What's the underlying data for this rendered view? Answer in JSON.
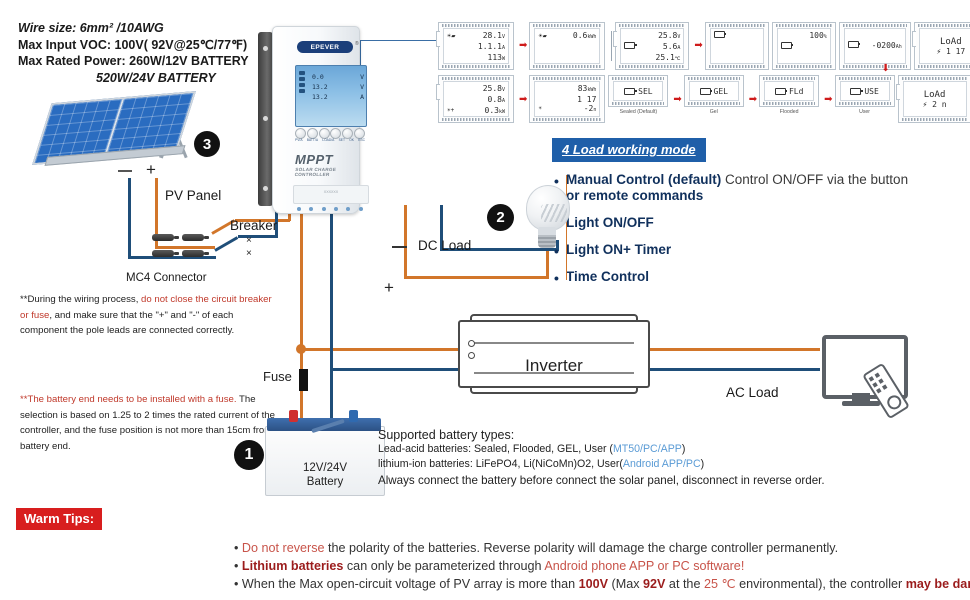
{
  "spec": {
    "line1": "Wire size: 6mm² /10AWG",
    "line2": "Max Input VOC: 100V( 92V@25℃/77℉)",
    "line3": "Max Rated  Power: 260W/12V BATTERY",
    "line4": "520W/24V BATTERY"
  },
  "controller": {
    "brand": "EPEVER",
    "brand_sup": "®",
    "mppt": "MPPT",
    "subtitle": "SOLAR CHARGE CONTROLLER",
    "lcd": [
      {
        "value": "0.0",
        "unit": "V"
      },
      {
        "value": "13.2",
        "unit": "V"
      },
      {
        "value": "13.2",
        "unit": "A"
      }
    ],
    "button_labels": [
      "PV/A",
      "BATT/A",
      "LOAD/A",
      "SET",
      "OK",
      "ESC"
    ],
    "foot_text": "XXXXXX"
  },
  "lcd_screens": {
    "row1": [
      {
        "icons": [
          "pv"
        ],
        "lines": [
          {
            "v": "28.1",
            "u": "V"
          },
          {
            "v": "1.1.1",
            "u": "A"
          },
          {
            "v": "113",
            "u": "W"
          }
        ]
      },
      {
        "icons": [
          "pv"
        ],
        "lines": [
          {
            "v": "0.6",
            "u": "kWh"
          }
        ]
      },
      {
        "icons": [
          "battery"
        ],
        "lines": [
          {
            "v": "25.8",
            "u": "V"
          },
          {
            "v": "5.6",
            "u": "A"
          },
          {
            "v": "25.1",
            "u": "℃"
          }
        ]
      },
      {
        "icons": [
          "battery"
        ],
        "lines": [
          {
            "v": "",
            "u": ""
          }
        ]
      },
      {
        "icons": [
          "battery"
        ],
        "lines": [
          {
            "v": "100",
            "u": "%"
          }
        ]
      },
      {
        "icons": [
          "battery"
        ],
        "lines": [
          {
            "v": "-0200",
            "u": "Ah"
          }
        ]
      },
      {
        "icons": [],
        "lines": [
          {
            "v": "LoAd",
            "u": ""
          },
          {
            "v": "⚡ 1 17",
            "u": ""
          }
        ]
      }
    ],
    "row2": [
      {
        "icons": [
          "battery"
        ],
        "lines": [
          {
            "v": "25.8",
            "u": "V"
          },
          {
            "v": "0.8",
            "u": "A"
          },
          {
            "v": "0.3",
            "u": "kW"
          }
        ],
        "caption": ""
      },
      {
        "icons": [
          "sun"
        ],
        "lines": [
          {
            "v": "83",
            "u": "kWh"
          },
          {
            "v": "1 17",
            "u": ""
          },
          {
            "v": "-2",
            "u": "n"
          }
        ],
        "caption": ""
      },
      {
        "icons": [
          "battery"
        ],
        "lines": [
          {
            "v": "SEL",
            "u": ""
          }
        ],
        "caption": "Sealed (Default)"
      },
      {
        "icons": [
          "battery"
        ],
        "lines": [
          {
            "v": "GEL",
            "u": ""
          }
        ],
        "caption": "Gel"
      },
      {
        "icons": [
          "battery"
        ],
        "lines": [
          {
            "v": "FLd",
            "u": ""
          }
        ],
        "caption": "Flooded"
      },
      {
        "icons": [
          "battery"
        ],
        "lines": [
          {
            "v": "USE",
            "u": ""
          }
        ],
        "caption": "User"
      },
      {
        "icons": [],
        "lines": [
          {
            "v": "LoAd",
            "u": ""
          },
          {
            "v": "⚡ 2 n",
            "u": ""
          }
        ],
        "caption": ""
      }
    ],
    "arrow_glyph": "➡"
  },
  "load_mode": {
    "title": "4 Load working mode",
    "items": [
      {
        "bold": "Manual Control (default)",
        "regular": " Control ON/OFF  via the button",
        "cont": "or remote commands"
      },
      {
        "bold": "Light ON/OFF",
        "regular": "",
        "cont": ""
      },
      {
        "bold": "Light ON+ Timer",
        "regular": "",
        "cont": ""
      },
      {
        "bold": "Time Control",
        "regular": "",
        "cont": ""
      }
    ],
    "bullet": "•"
  },
  "labels": {
    "pv_panel": "PV Panel",
    "mc4": "MC4 Connector",
    "breaker": "Breaker",
    "dc_load": "DC Load",
    "fuse": "Fuse",
    "inverter": "Inverter",
    "ac_load": "AC Load",
    "battery_line1": "12V/24V",
    "battery_line2": "Battery",
    "plus": "+",
    "minus": "—",
    "x": "×"
  },
  "markers": {
    "one": "1",
    "two": "2",
    "three": "3"
  },
  "note1": {
    "pre": "**During the wiring process, ",
    "red": "do not close the circuit breaker or fuse",
    "post": ", and make sure that the \"+\" and \"-\" of each component the pole leads are connected correctly."
  },
  "note2": {
    "red": "**The battery end needs to be installed with a fuse.",
    "rest": "The selection is based on 1.25 to 2 times the rated current of the controller, and the fuse position is not more than 15cm from the battery end."
  },
  "battery_types": {
    "title": "Supported battery types:",
    "lead_acid": "Lead-acid batteries: Sealed, Flooded, GEL, User (",
    "lead_acid_link": "MT50/PC/APP",
    "lead_acid_end": ")",
    "lithium": "lithium-ion batteries: LiFePO4, Li(NiCoMn)O2, User(",
    "lithium_link": "Android APP/PC",
    "lithium_end": ")",
    "always": "Always connect the battery before connect the solar panel, disconnect in reverse order."
  },
  "warm_tips": {
    "tag": "Warm Tips:",
    "bullet": "•",
    "line1_red": "Do not reverse",
    "line1_rest": " the polarity of the batteries. Reverse polarity will damage the charge controller permanently.",
    "line2_red": "Lithium batteries",
    "line2_mid": " can only be parameterized through ",
    "line2_red2": "Android phone APP or PC software!",
    "line3_a": "When the Max open-circuit voltage of PV array is more than ",
    "line3_b": "100V",
    "line3_c": " (Max ",
    "line3_d": "92V",
    "line3_e": " at the ",
    "line3_f": "25 ℃",
    "line3_g": " environmental), the controller ",
    "line3_h": "may be damaged"
  },
  "colors": {
    "positive_wire": "#d2762a",
    "negative_wire": "#1f4e79",
    "accent_blue": "#1f5fa9",
    "warn_red": "#d81e1e"
  }
}
